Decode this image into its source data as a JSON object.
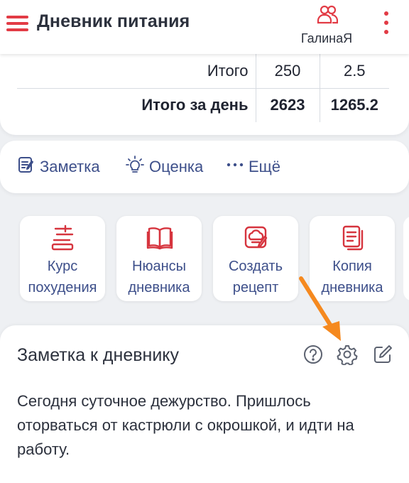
{
  "header": {
    "menu_icon": "hamburger-menu-icon",
    "title": "Дневник питания",
    "user_icon": "users-icon",
    "user_name": "ГалинаЯ",
    "more_icon": "more-vertical-icon",
    "accent_color": "#e23b45"
  },
  "totals": {
    "rows": [
      {
        "label": "Итого",
        "value1": "250",
        "value2": "2.5"
      },
      {
        "label": "Итого за день",
        "value1": "2623",
        "value2": "1265.2"
      }
    ]
  },
  "actions": {
    "note_label": "Заметка",
    "rating_label": "Оценка",
    "more_label": "Ещё",
    "link_color": "#3d4f8a"
  },
  "tiles": [
    {
      "line1": "Курс",
      "line2": "похудения",
      "icon": "scale-icon"
    },
    {
      "line1": "Нюансы",
      "line2": "дневника",
      "icon": "book-icon"
    },
    {
      "line1": "Создать",
      "line2": "рецепт",
      "icon": "chef-hat-icon"
    },
    {
      "line1": "Копия",
      "line2": "дневника",
      "icon": "copy-document-icon"
    }
  ],
  "note": {
    "title": "Заметка к дневнику",
    "help_icon": "help-circle-icon",
    "settings_icon": "gear-icon",
    "edit_icon": "edit-icon",
    "text": "Сегодня суточное дежурство. Пришлось оторваться от кастрюли с окрошкой, и идти на работу."
  },
  "annotation": {
    "arrow_color": "#f5891f"
  }
}
